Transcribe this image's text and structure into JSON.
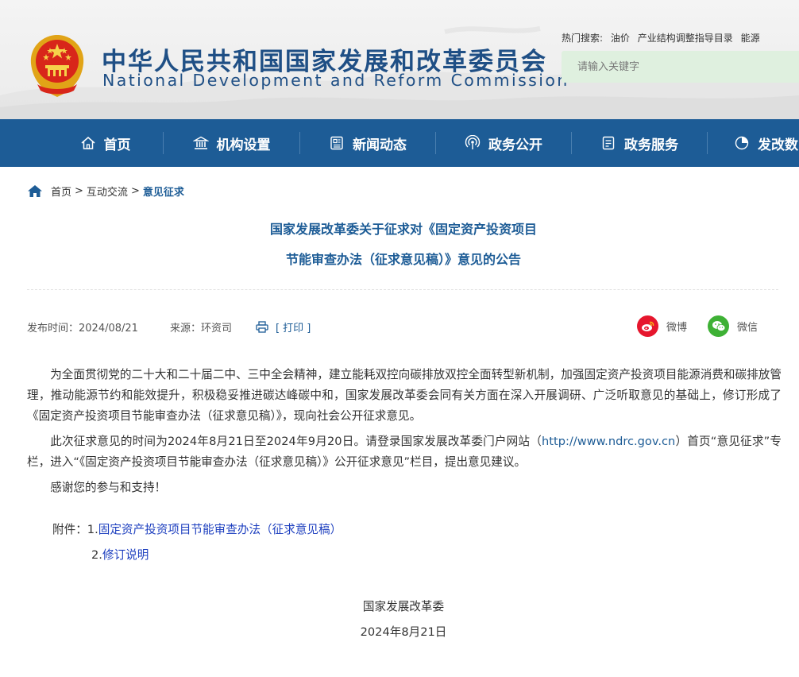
{
  "header": {
    "title_cn": "中华人民共和国国家发展和改革委员会",
    "title_en": "National Development and Reform Commission",
    "hot_search_label": "热门搜索:",
    "hot_search_links": [
      "油价",
      "产业结构调整指导目录",
      "能源"
    ],
    "search_placeholder": "请输入关键字"
  },
  "nav": {
    "items": [
      {
        "label": "首页",
        "icon": "home-icon"
      },
      {
        "label": "机构设置",
        "icon": "building-icon"
      },
      {
        "label": "新闻动态",
        "icon": "newspaper-icon"
      },
      {
        "label": "政务公开",
        "icon": "broadcast-icon"
      },
      {
        "label": "政务服务",
        "icon": "document-icon"
      },
      {
        "label": "发改数",
        "icon": "pie-chart-icon"
      }
    ]
  },
  "breadcrumb": {
    "home": "首页",
    "sep": ">",
    "section": "互动交流",
    "current": "意见征求"
  },
  "article": {
    "title_line1": "国家发展改革委关于征求对《固定资产投资项目",
    "title_line2": "节能审查办法（征求意见稿）》意见的公告",
    "publish_time": "发布时间：2024/08/21",
    "source": "来源：环资司",
    "print_label": "[ 打印 ]",
    "share_weibo": "微博",
    "share_wechat": "微信",
    "para1": "为全面贯彻党的二十大和二十届二中、三中全会精神，建立能耗双控向碳排放双控全面转型新机制，加强固定资产投资项目能源消费和碳排放管理，推动能源节约和能效提升，积极稳妥推进碳达峰碳中和，国家发展改革委会同有关方面在深入开展调研、广泛听取意见的基础上，修订形成了《固定资产投资项目节能审查办法（征求意见稿）》，现向社会公开征求意见。",
    "para2_a": "此次征求意见的时间为2024年8月21日至2024年9月20日。请登录国家发展改革委门户网站（",
    "para2_link": "http://www.ndrc.gov.cn",
    "para2_b": "）首页“意见征求”专栏，进入“《固定资产投资项目节能审查办法（征求意见稿）》公开征求意见”栏目，提出意见建议。",
    "para3": "感谢您的参与和支持！",
    "attach_label": "附件：",
    "attach1_num": "1.",
    "attach1_link": "固定资产投资项目节能审查办法（征求意见稿）",
    "attach2_num": "2.",
    "attach2_link": "修订说明",
    "sign_org": "国家发展改革委",
    "sign_date": "2024年8月21日"
  },
  "colors": {
    "nav_bg": "#1d5c96",
    "title_blue": "#1d5c96",
    "search_bg": "#dff0df",
    "weibo_red": "#e6162d",
    "wechat_green": "#3eb135"
  }
}
